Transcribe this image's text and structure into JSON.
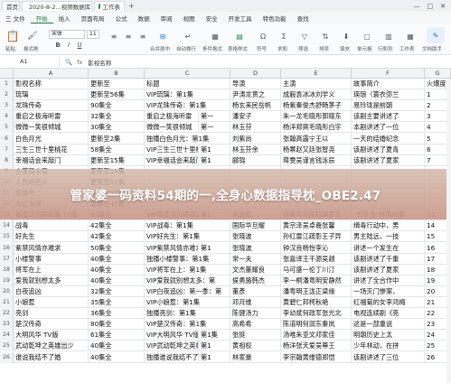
{
  "tabs": [
    {
      "label": "首页"
    },
    {
      "label": "2020-8-2...视频数据库.xlsx"
    },
    {
      "label": "工作表"
    }
  ],
  "window_controls": [
    "—",
    "□",
    "✕"
  ],
  "menu": [
    "三 文件",
    "开始",
    "插入",
    "页面布局",
    "公式",
    "数据",
    "审阅",
    "视图",
    "安全",
    "开发工具",
    "特色功能",
    "查找"
  ],
  "ribbon": {
    "font_name": "宋体",
    "font_size": "11",
    "labels": {
      "paste": "粘贴",
      "format_painter": "格式刷",
      "merge": "合并居中",
      "wrap": "自动换行",
      "conditional": "条件格式",
      "table_style": "表格样式",
      "symbol": "符号",
      "sum": "求和",
      "filter": "筛选",
      "sort": "排序",
      "fill": "填充",
      "cell": "单元格",
      "rows_cols": "行和列",
      "worksheet": "工作表",
      "freeze": "冻结窗格",
      "doc_assist": "文档助手"
    }
  },
  "formula_bar": {
    "cell_ref": "A1",
    "fx": "fx",
    "content": "影视名称"
  },
  "columns": [
    "A",
    "B",
    "C",
    "D",
    "E",
    "F",
    "G",
    "H"
  ],
  "overlay_text": "管家婆一码资料54期的一,全身心数据指导枕_OBE2.47",
  "rows": [
    {
      "n": "1",
      "cells": [
        "影视名称",
        "更新至",
        "标题",
        "",
        "导演",
        "主演",
        "故事简介",
        "火爆度"
      ]
    },
    {
      "n": "2",
      "cells": [
        "琉璃",
        "更新至56集",
        "VIP琉璃：第1集",
        "",
        "尹涛龙贯之",
        "成毅袁冰冰刘学义",
        "瑛琅（蓑衣弥兰",
        "1"
      ]
    },
    {
      "n": "3",
      "cells": [
        "龙珠传奇",
        "90集全",
        "VIP龙珠传奇：第1集",
        "",
        "杨玄来民岳帆",
        "杨紫秦俊杰舒畅茅子",
        "易玲珑是前朝",
        "2"
      ]
    },
    {
      "n": "4",
      "cells": [
        "重启之极海听雷",
        "32集全",
        "重启之极海听雷",
        "第一",
        "潘安子",
        "朱一龙毛晓彤郭晓东",
        "该剧主要讲述了",
        "3"
      ]
    },
    {
      "n": "5",
      "cells": [
        "微微一笑很倾城",
        "30集全",
        "微微一笑很倾城",
        "第一",
        "林玉芬",
        "杨洋郑爽毛晓彤白宇",
        "本剧讲述了一位",
        "4"
      ]
    },
    {
      "n": "6",
      "cells": [
        "白色月光",
        "更新至2集",
        "独播白色月光：第1集",
        "",
        "刘紫尚",
        "张翰高露宁王以",
        "一天的结婚纪念",
        "5"
      ]
    },
    {
      "n": "7",
      "cells": [
        "三生三世十里桃花",
        "58集全",
        "VIP三生三世十里桃花",
        "第1",
        "林玉芬余",
        "杨幂赵又廷张智尧",
        "该剧讲述了夏青",
        "6"
      ]
    },
    {
      "n": "8",
      "cells": [
        "幸福话会来敲门",
        "更新至15集",
        "VIP幸福话会来敲门",
        "第1",
        "郦锦",
        "蒋雯吴谨言钱泳辰",
        "该剧讲述了夏家",
        "7"
      ]
    },
    {
      "n": "9",
      "cells": [
        "古董局中局",
        "更新至15集",
        "",
        "",
        "",
        "",
        "",
        ""
      ]
    },
    {
      "n": "10",
      "cells": [
        "人民的名义",
        "更新至55集",
        "",
        "",
        "",
        "",
        "",
        ""
      ]
    },
    {
      "n": "11",
      "cells": [
        "陈情令",
        "更新至50集",
        "",
        "",
        "",
        "",
        "",
        ""
      ]
    },
    {
      "n": "12",
      "cells": [
        "大江大河",
        "更新至47集",
        "",
        "",
        "",
        "",
        "",
        ""
      ]
    },
    {
      "n": "13",
      "cells": [
        "香蜜沉沉烬如霜 TV版",
        "63集全",
        "VIP香蜜沉沉烬如霜",
        "第1",
        "朱锐斌",
        "杨紫邓伦陈钰琪罗云",
        "\"长芳主\"所情地要",
        "13"
      ]
    },
    {
      "n": "14",
      "cells": [
        "战毒",
        "42集全",
        "VIP战毒：第1集",
        "",
        "国际华旦耀",
        "黄宗泽吴卓羲张馨",
        "缉毒行动中，男",
        "14"
      ]
    },
    {
      "n": "15",
      "cells": [
        "好先生",
        "42集全",
        "VIP好先生：第1集",
        "",
        "张晓波",
        "孙红雷江疏影王子异",
        "男主陆远，一技",
        "15"
      ]
    },
    {
      "n": "16",
      "cells": [
        "紫禁风情亦难求",
        "50集全",
        "VIP紫禁风情亦难求",
        "第1",
        "张晓波",
        "钟汉良杨怡李沁",
        "讲述一个发生在",
        "16"
      ]
    },
    {
      "n": "17",
      "cells": [
        "小楼警事",
        "40集全",
        "独播小楼警事：第1集",
        "",
        "常一夫",
        "张嘉译王干源吴越",
        "该剧讲述了千重",
        "17"
      ]
    },
    {
      "n": "18",
      "cells": [
        "将军在上",
        "40集全",
        "VIP将军在上：第1集",
        "",
        "文杰董耀良",
        "马可盛一伦丁川汀",
        "该剧讲述了夏家",
        "18"
      ]
    },
    {
      "n": "19",
      "cells": [
        "爱我就别想太多",
        "40集全",
        "VIP爱我就别想太多：第",
        "",
        "侯勇骆韩杰",
        "李一桐潘粤明安静然",
        "讲述了全合作中",
        "19"
      ]
    },
    {
      "n": "20",
      "cells": [
        "白夜追凶",
        "32集全",
        "VIP白夜追凶：第一季：第",
        "",
        "董彥",
        "潘粤明王泷正梁缘",
        "一场灭门惨案，",
        "20"
      ]
    },
    {
      "n": "21",
      "cells": [
        "小娘惹",
        "35集全",
        "VIP小娘惹：第1集",
        "",
        "邓月维",
        "黄碧仁邦柯秋艳",
        "红福菊的女李鸿梅",
        "21"
      ]
    },
    {
      "n": "22",
      "cells": [
        "亮剑",
        "36集全",
        "独播亮剑：第1集",
        "",
        "陈健汤力",
        "李幼斌何政军张光北",
        "电视连续剧《亮",
        "22"
      ]
    },
    {
      "n": "23",
      "cells": [
        "楚汉传奇",
        "80集全",
        "VIP楚汉传奇：第1集",
        "",
        "高希希",
        "陈道明何润东秦岚",
        "这是一部重说",
        "23"
      ]
    },
    {
      "n": "24",
      "cells": [
        "大明风华 TV版",
        "61集全",
        "VIP大明风华 TV版",
        "第1集",
        "张挺",
        "汤唯朱亚文邓家佳",
        "明朝历史上太",
        "24"
      ]
    },
    {
      "n": "25",
      "cells": [
        "武动乾坤之英雄出少",
        "40集全",
        "VIP武动乾坤之英雄出",
        "第1",
        "黄祖权",
        "杨洋张天爱吴尊王",
        "少年林动，在拼",
        "25"
      ]
    },
    {
      "n": "26",
      "cells": [
        "谁说我结不了婚",
        "40集全",
        "独播谁说我结不了婚",
        "第1",
        "林家豪",
        "李宗翰黄维德郑恺",
        "该剧讲述了三位",
        "26"
      ]
    }
  ]
}
